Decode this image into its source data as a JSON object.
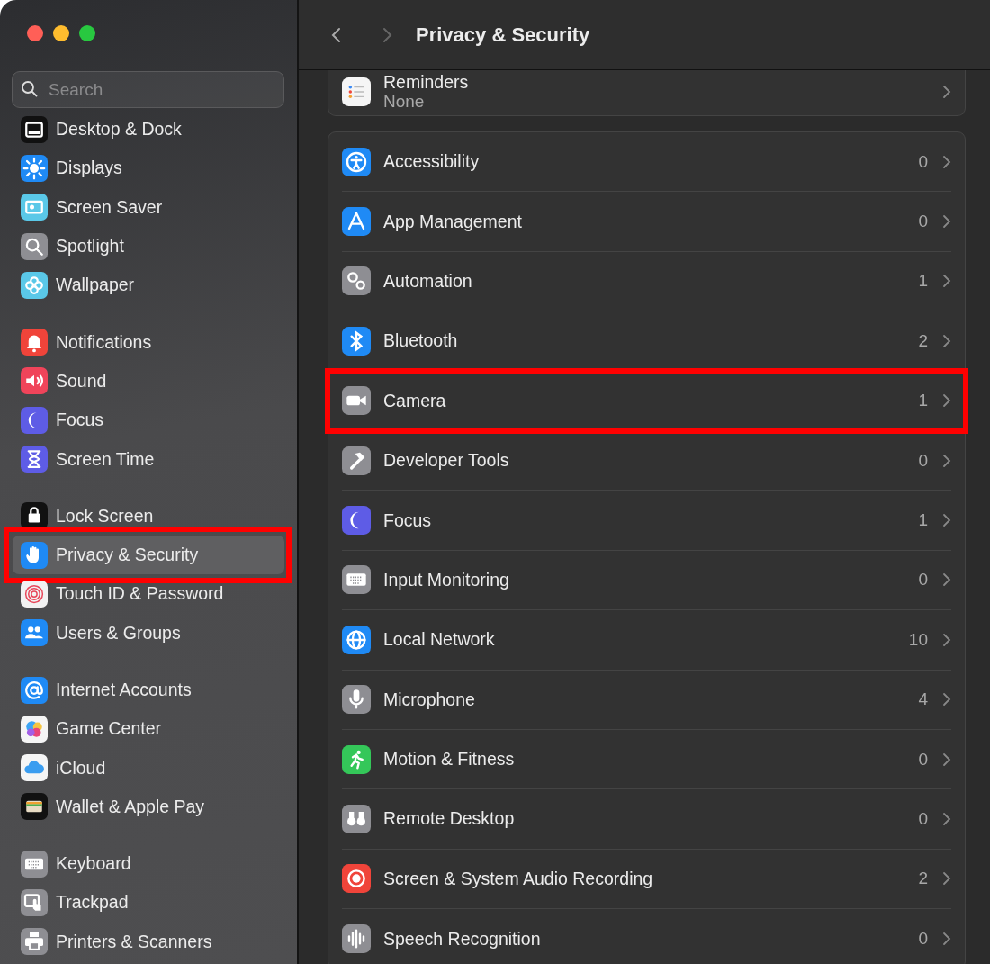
{
  "window": {
    "title": "Privacy & Security"
  },
  "sidebar": {
    "search": {
      "placeholder": "Search"
    },
    "groups": [
      {
        "items": [
          {
            "label": "Desktop & Dock",
            "selected": false,
            "annotated": false
          },
          {
            "label": "Displays",
            "selected": false,
            "annotated": false
          },
          {
            "label": "Screen Saver",
            "selected": false,
            "annotated": false
          },
          {
            "label": "Spotlight",
            "selected": false,
            "annotated": false
          },
          {
            "label": "Wallpaper",
            "selected": false,
            "annotated": false
          }
        ]
      },
      {
        "items": [
          {
            "label": "Notifications",
            "selected": false,
            "annotated": false
          },
          {
            "label": "Sound",
            "selected": false,
            "annotated": false
          },
          {
            "label": "Focus",
            "selected": false,
            "annotated": false
          },
          {
            "label": "Screen Time",
            "selected": false,
            "annotated": false
          }
        ]
      },
      {
        "items": [
          {
            "label": "Lock Screen",
            "selected": false,
            "annotated": false
          },
          {
            "label": "Privacy & Security",
            "selected": true,
            "annotated": true
          },
          {
            "label": "Touch ID & Password",
            "selected": false,
            "annotated": false
          },
          {
            "label": "Users & Groups",
            "selected": false,
            "annotated": false
          }
        ]
      },
      {
        "items": [
          {
            "label": "Internet Accounts",
            "selected": false,
            "annotated": false
          },
          {
            "label": "Game Center",
            "selected": false,
            "annotated": false
          },
          {
            "label": "iCloud",
            "selected": false,
            "annotated": false
          },
          {
            "label": "Wallet & Apple Pay",
            "selected": false,
            "annotated": false
          }
        ]
      },
      {
        "items": [
          {
            "label": "Keyboard",
            "selected": false,
            "annotated": false
          },
          {
            "label": "Trackpad",
            "selected": false,
            "annotated": false
          },
          {
            "label": "Printers & Scanners",
            "selected": false,
            "annotated": false
          }
        ]
      }
    ]
  },
  "reminders": {
    "label": "Reminders",
    "value": "None"
  },
  "permissions": [
    {
      "label": "Accessibility",
      "count": "0",
      "annotated": false
    },
    {
      "label": "App Management",
      "count": "0",
      "annotated": false
    },
    {
      "label": "Automation",
      "count": "1",
      "annotated": false
    },
    {
      "label": "Bluetooth",
      "count": "2",
      "annotated": false
    },
    {
      "label": "Camera",
      "count": "1",
      "annotated": true
    },
    {
      "label": "Developer Tools",
      "count": "0",
      "annotated": false
    },
    {
      "label": "Focus",
      "count": "1",
      "annotated": false
    },
    {
      "label": "Input Monitoring",
      "count": "0",
      "annotated": false
    },
    {
      "label": "Local Network",
      "count": "10",
      "annotated": false
    },
    {
      "label": "Microphone",
      "count": "4",
      "annotated": false
    },
    {
      "label": "Motion & Fitness",
      "count": "0",
      "annotated": false
    },
    {
      "label": "Remote Desktop",
      "count": "0",
      "annotated": false
    },
    {
      "label": "Screen & System Audio Recording",
      "count": "2",
      "annotated": false
    },
    {
      "label": "Speech Recognition",
      "count": "0",
      "annotated": false
    }
  ]
}
